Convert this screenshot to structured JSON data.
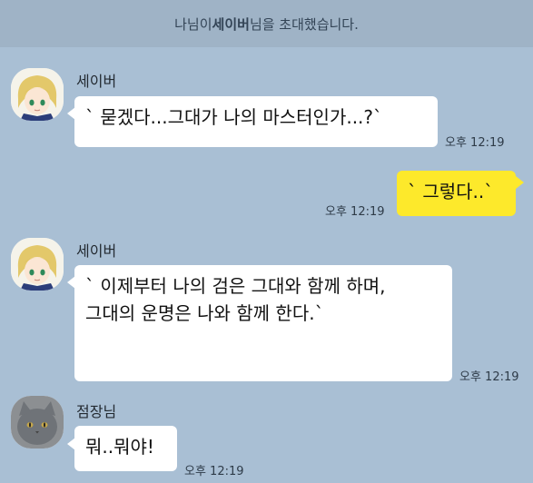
{
  "notice": {
    "prefix": "나님이 ",
    "invitee": "세이버",
    "suffix": "님을 초대했습니다."
  },
  "messages": [
    {
      "sender": "세이버",
      "text": "` 묻겠다...그대가 나의 마스터인가...?`",
      "time": "오후 12:19"
    },
    {
      "sender": "",
      "text": "` 그렇다..`",
      "time": "오후 12:19"
    },
    {
      "sender": "세이버",
      "text_line1": "` 이제부터 나의 검은 그대와 함께 하며,",
      "text_line2": "그대의 운명은 나와 함께 한다.`",
      "time": "오후 12:19"
    },
    {
      "sender": "점장님",
      "text": "뭐..뭐야!",
      "time": "오후 12:19"
    }
  ],
  "colors": {
    "background": "#a9bfd4",
    "notice_bar": "#9fb3c6",
    "my_bubble": "#fde92b",
    "other_bubble": "#ffffff"
  },
  "icons": {
    "saber_avatar": "saber-avatar-icon",
    "manager_avatar": "cat-avatar-icon"
  }
}
